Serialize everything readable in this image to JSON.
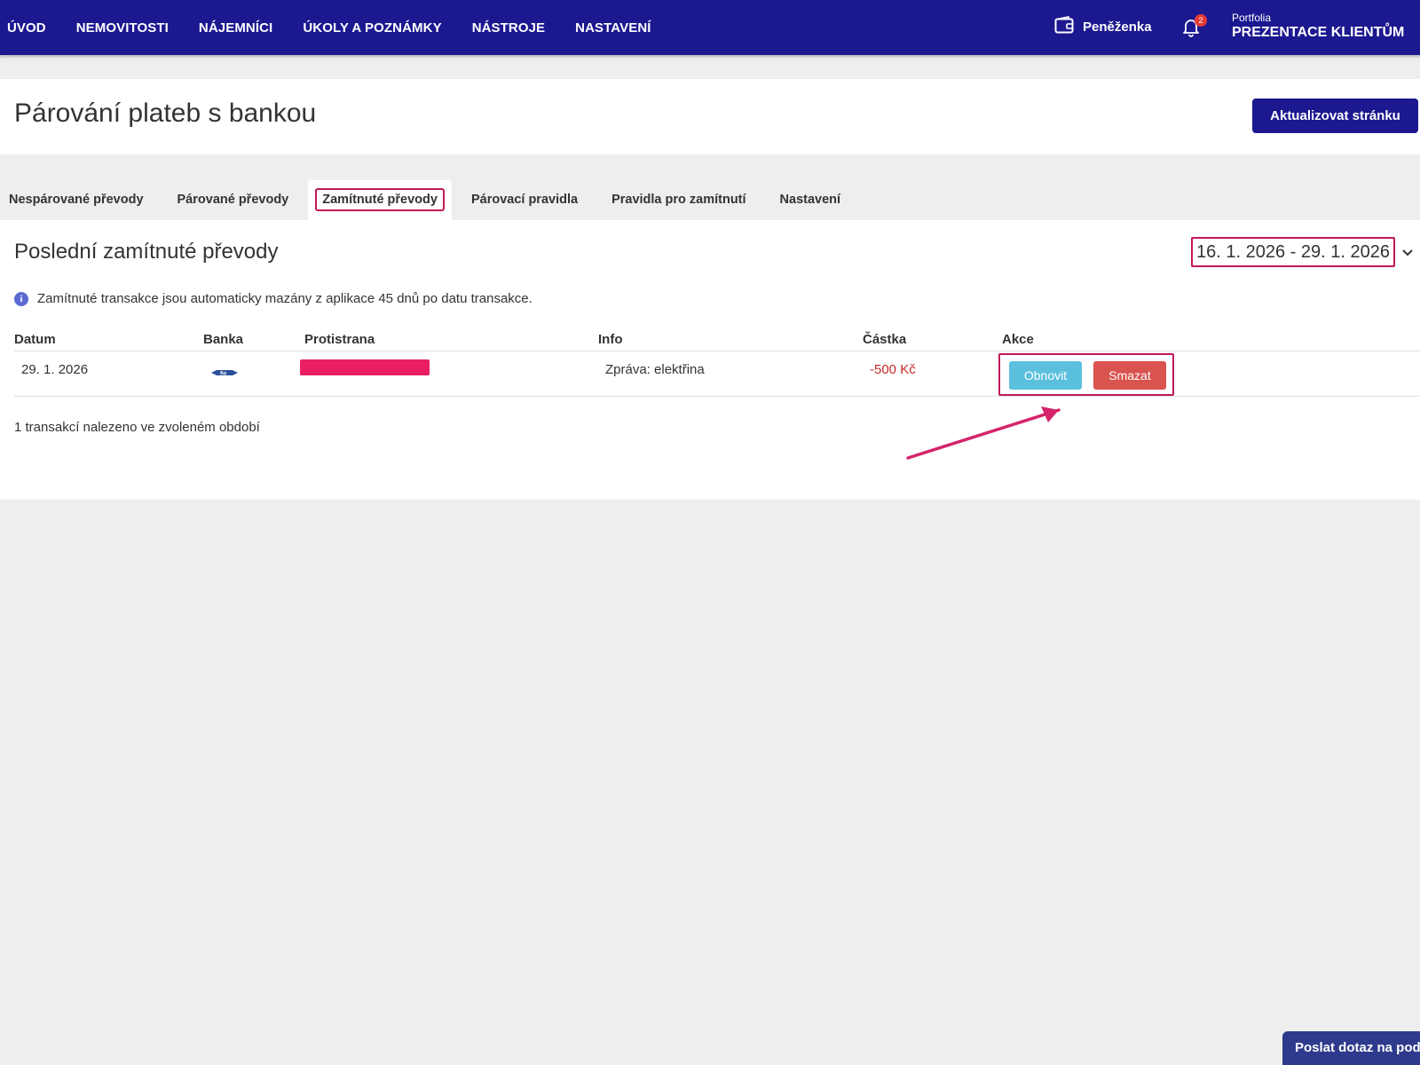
{
  "nav": {
    "items": [
      "ÚVOD",
      "NEMOVITOSTI",
      "NÁJEMNÍCI",
      "ÚKOLY A POZNÁMKY",
      "NÁSTROJE",
      "NASTAVENÍ"
    ],
    "wallet_label": "Peněženka",
    "notification_count": "2",
    "portfolio_label": "Portfolia",
    "portfolio_name": "PREZENTACE KLIENTŮM"
  },
  "header": {
    "title": "Párování plateb s bankou",
    "refresh_label": "Aktualizovat stránku"
  },
  "tabs": [
    {
      "label": "Nespárované převody",
      "active": false
    },
    {
      "label": "Párované převody",
      "active": false
    },
    {
      "label": "Zamítnuté převody",
      "active": true
    },
    {
      "label": "Párovací pravidla",
      "active": false
    },
    {
      "label": "Pravidla pro zamítnutí",
      "active": false
    },
    {
      "label": "Nastavení",
      "active": false
    }
  ],
  "section": {
    "title": "Poslední zamítnuté převody",
    "date_range": "16. 1. 2026 - 29. 1. 2026",
    "info_text": "Zamítnuté transakce jsou automaticky mazány z aplikace 45 dnů po datu transakce."
  },
  "table": {
    "columns": [
      "Datum",
      "Banka",
      "Protistrana",
      "Info",
      "Částka",
      "Akce"
    ],
    "rows": [
      {
        "date": "29. 1. 2026",
        "bank_icon": "fio-bank-logo",
        "counterparty": "",
        "info": "Zpráva: elektřina",
        "amount": "-500 Kč",
        "restore_label": "Obnovit",
        "delete_label": "Smazat"
      }
    ],
    "count_text": "1 transakcí nalezeno ve zvoleném období"
  },
  "support": {
    "label": "Poslat dotaz na podporu"
  },
  "colors": {
    "nav_bg": "#1c1890",
    "highlight": "#c2185b",
    "restore": "#5bc0de",
    "delete": "#d9534f",
    "amount_negative": "#c62828"
  }
}
